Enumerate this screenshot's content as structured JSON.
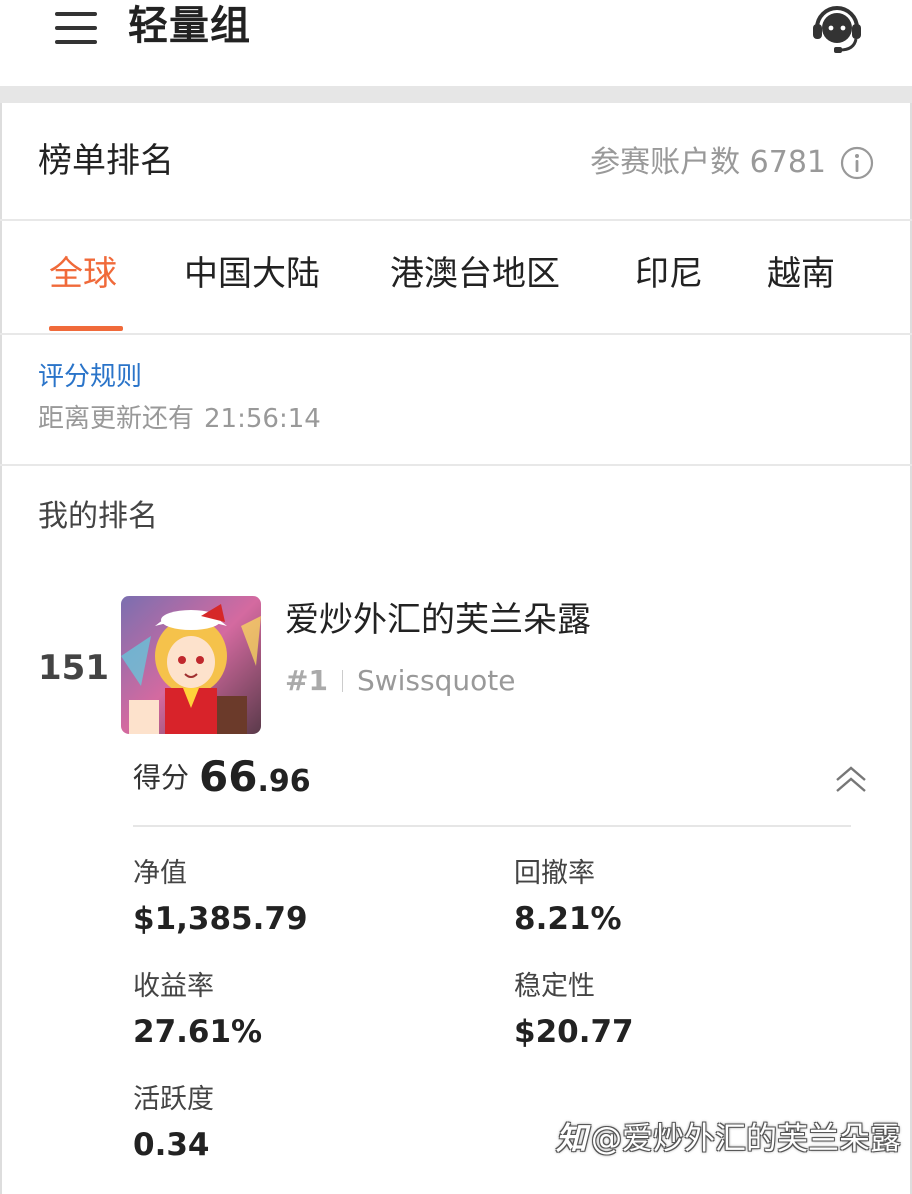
{
  "header": {
    "title": "轻量组",
    "menu_icon": "hamburger-menu-icon",
    "support_icon": "headset-support-icon"
  },
  "ranking_header": {
    "title": "榜单排名",
    "participant_label": "参赛账户数",
    "participant_count": "6781",
    "info_icon": "info-icon"
  },
  "tabs": [
    {
      "label": "全球",
      "active": true
    },
    {
      "label": "中国大陆",
      "active": false
    },
    {
      "label": "港澳台地区",
      "active": false
    },
    {
      "label": "印尼",
      "active": false
    },
    {
      "label": "越南",
      "active": false
    }
  ],
  "rules": {
    "link_label": "评分规则",
    "countdown_label": "距离更新还有",
    "countdown_time": "21:56:14"
  },
  "my_ranking": {
    "title": "我的排名",
    "rank": "151",
    "nickname": "爱炒外汇的芙兰朵露",
    "broker_rank": "#1",
    "broker": "Swissquote",
    "score_label": "得分",
    "score_integer": "66",
    "score_decimal": ".96",
    "stats": [
      {
        "label": "净值",
        "value": "$1,385.79"
      },
      {
        "label": "回撤率",
        "value": "8.21%"
      },
      {
        "label": "收益率",
        "value": "27.61%"
      },
      {
        "label": "稳定性",
        "value": "$20.77"
      },
      {
        "label": "活跃度",
        "value": "0.34"
      }
    ]
  },
  "watermark": {
    "logo": "知",
    "text": "@爱炒外汇的芙兰朵露"
  },
  "colors": {
    "accent": "#f06a3a",
    "link": "#2a74c9",
    "muted": "#999999",
    "band": "#e6e6e6"
  }
}
